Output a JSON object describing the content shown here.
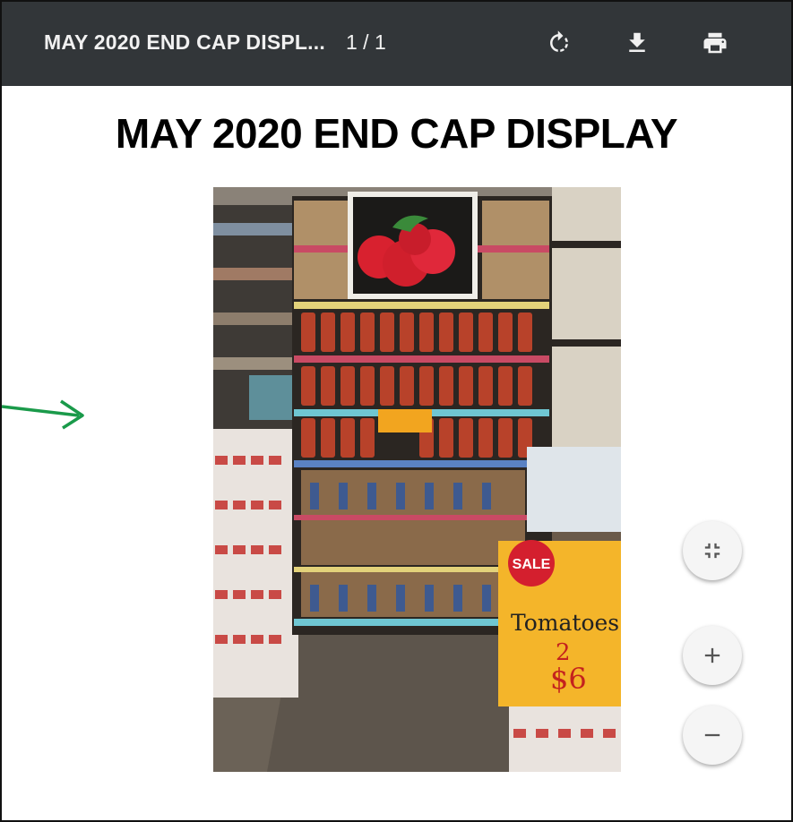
{
  "toolbar": {
    "document_title": "MAY 2020 END CAP DISPL...",
    "page_indicator": "1 / 1",
    "icons": {
      "rotate": "rotate-icon",
      "download": "download-icon",
      "print": "print-icon"
    }
  },
  "page": {
    "heading": "MAY 2020 END CAP DISPLAY",
    "photo": {
      "sign_sale": "SALE",
      "sign_product": "Tomatoes",
      "sign_qty": "2",
      "sign_price": "$6"
    }
  },
  "zoom_controls": {
    "icons": {
      "fit": "fit-to-page-icon",
      "zoom_in": "zoom-in-icon",
      "zoom_out": "zoom-out-icon"
    }
  },
  "colors": {
    "toolbar_bg": "#323639",
    "arrow": "#1a9a4a",
    "fab_bg": "#f5f5f5"
  }
}
